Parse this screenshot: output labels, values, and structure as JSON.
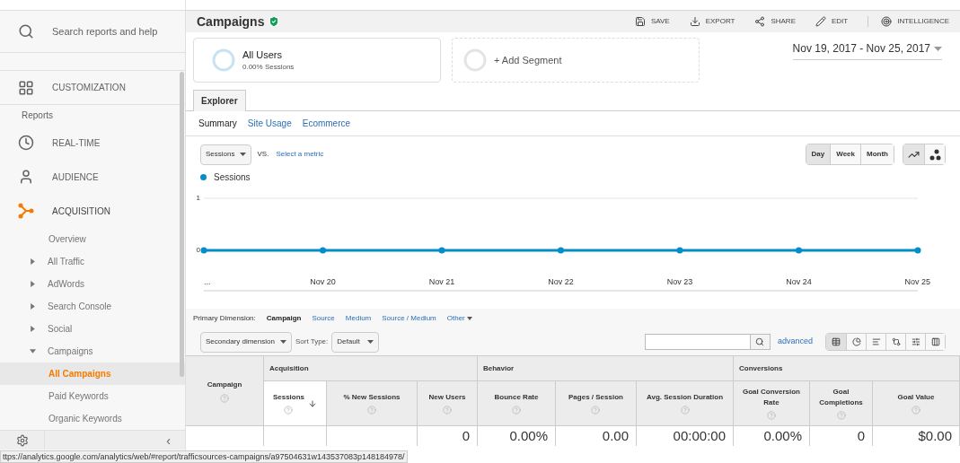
{
  "sidebar": {
    "search_placeholder": "Search reports and help",
    "items": [
      {
        "kind": "section",
        "label": "CUSTOMIZATION",
        "active": false
      },
      {
        "kind": "heading",
        "label": "Reports"
      },
      {
        "kind": "section",
        "label": "REAL-TIME",
        "active": false
      },
      {
        "kind": "section",
        "label": "AUDIENCE",
        "active": false
      },
      {
        "kind": "section",
        "label": "ACQUISITION",
        "active": true
      },
      {
        "kind": "link",
        "label": "Overview",
        "selected": false
      },
      {
        "kind": "group",
        "label": "All Traffic",
        "expanded": false
      },
      {
        "kind": "group",
        "label": "AdWords",
        "expanded": false
      },
      {
        "kind": "group",
        "label": "Search Console",
        "expanded": false
      },
      {
        "kind": "group",
        "label": "Social",
        "expanded": false
      },
      {
        "kind": "group",
        "label": "Campaigns",
        "expanded": true
      },
      {
        "kind": "child",
        "label": "All Campaigns",
        "selected": true
      },
      {
        "kind": "child",
        "label": "Paid Keywords",
        "selected": false
      },
      {
        "kind": "child",
        "label": "Organic Keywords",
        "selected": false
      }
    ],
    "collapse": "‹"
  },
  "header": {
    "title": "Campaigns",
    "actions": [
      "SAVE",
      "EXPORT",
      "SHARE",
      "EDIT",
      "INTELLIGENCE"
    ]
  },
  "segments": [
    {
      "kind": "segment",
      "name": "All Users",
      "detail": "0.00% Sessions"
    },
    {
      "kind": "add",
      "name": "+ Add Segment"
    }
  ],
  "date_range": "Nov 19, 2017 - Nov 25, 2017",
  "tabs": [
    {
      "label": "Explorer",
      "selected": true
    }
  ],
  "subtabs": [
    {
      "label": "Summary",
      "selected": true
    },
    {
      "label": "Site Usage",
      "selected": false
    },
    {
      "label": "Ecommerce",
      "selected": false
    }
  ],
  "metric": {
    "value": "Sessions",
    "vs": "VS.",
    "link": "Select a metric"
  },
  "periods": [
    {
      "label": "Day",
      "selected": true
    },
    {
      "label": "Week",
      "selected": false
    },
    {
      "label": "Month",
      "selected": false
    }
  ],
  "chart_types": [
    {
      "selected": true
    },
    {
      "selected": false
    }
  ],
  "chart": {
    "chart_data": {
      "type": "line",
      "categories": [
        "...",
        "Nov 20",
        "Nov 21",
        "Nov 22",
        "Nov 23",
        "Nov 24",
        "Nov 25"
      ],
      "ylim": [
        0,
        1
      ],
      "yticks": [
        0,
        1
      ],
      "series": [
        {
          "name": "Sessions",
          "color": "#058dc7",
          "marker": true,
          "values": [
            0,
            0,
            0,
            0,
            0,
            0,
            0
          ]
        }
      ]
    }
  },
  "primary_dimension": {
    "label": "Primary Dimension:",
    "options": [
      {
        "label": "Campaign",
        "selected": true,
        "menu": false
      },
      {
        "label": "Source",
        "selected": false,
        "menu": false
      },
      {
        "label": "Medium",
        "selected": false,
        "menu": false
      },
      {
        "label": "Source / Medium",
        "selected": false,
        "menu": false
      },
      {
        "label": "Other",
        "selected": false,
        "menu": true
      }
    ]
  },
  "table_controls": {
    "secondary": "Secondary dimension",
    "sort_label": "Sort Type:",
    "sort_value": "Default",
    "advanced": "advanced",
    "views": [
      {
        "selected": true
      },
      {
        "selected": false
      },
      {
        "selected": false
      },
      {
        "selected": false
      },
      {
        "selected": false
      },
      {
        "selected": false
      }
    ]
  },
  "table": {
    "groups": [
      "Acquisition",
      "Behavior",
      "Conversions"
    ],
    "columns": [
      {
        "label": "Campaign",
        "sorted": false
      },
      {
        "label": "Sessions",
        "sorted": true
      },
      {
        "label": "% New Sessions",
        "sorted": false
      },
      {
        "label": "New Users",
        "sorted": false
      },
      {
        "label": "Bounce Rate",
        "sorted": false
      },
      {
        "label": "Pages / Session",
        "sorted": false
      },
      {
        "label": "Avg. Session Duration",
        "sorted": false
      },
      {
        "label": "Goal Conversion Rate",
        "sorted": false
      },
      {
        "label": "Goal Completions",
        "sorted": false
      },
      {
        "label": "Goal Value",
        "sorted": false
      }
    ],
    "rows": [
      {
        "cells": [
          null,
          null,
          null,
          "0",
          "0.00%",
          "0.00",
          "00:00:00",
          "0.00%",
          "0",
          "$0.00"
        ]
      }
    ]
  },
  "status_url": "ttps://analytics.google.com/analytics/web/#report/trafficsources-campaigns/a97504631w143537083p148184978/"
}
